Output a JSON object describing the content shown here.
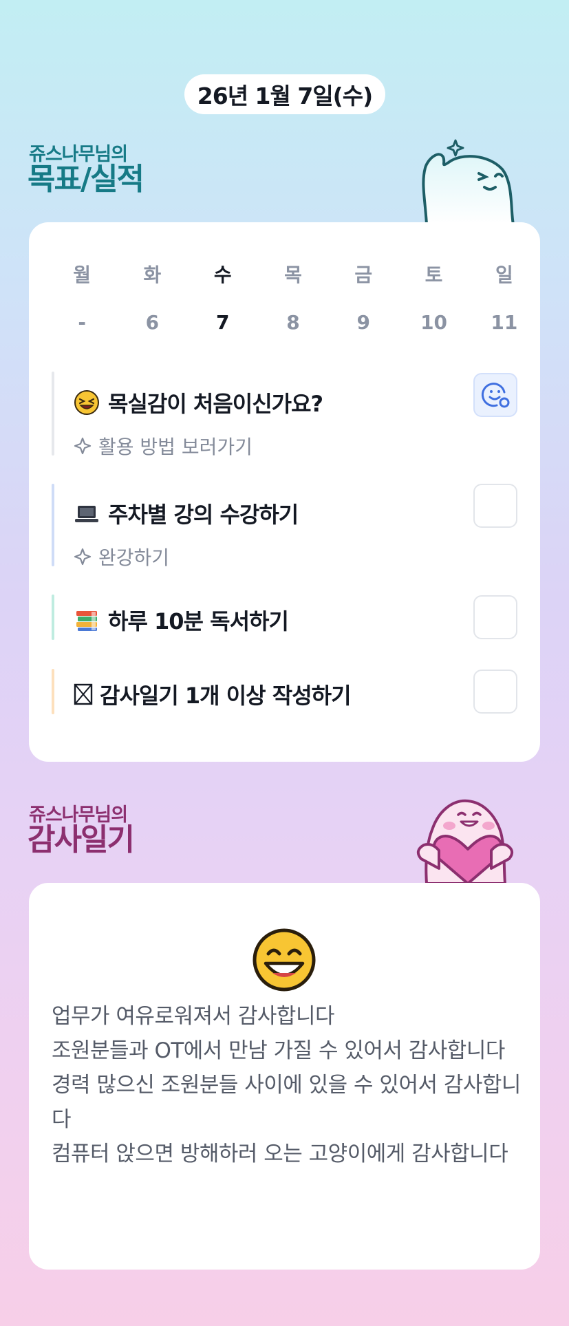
{
  "date": "26년 1월 7일(수)",
  "goals_section": {
    "subtitle": "쥬스나무님의",
    "title": "목표/실적"
  },
  "week": {
    "days": [
      "월",
      "화",
      "수",
      "목",
      "금",
      "토",
      "일"
    ],
    "dates": [
      "-",
      "6",
      "7",
      "8",
      "9",
      "10",
      "11"
    ],
    "today_index": 2
  },
  "goals": [
    {
      "emoji_icon": "grinning-squinting-face-icon",
      "title": "목실감이 처음이신가요?",
      "sub": "활용 방법 보러가기",
      "bar_color": "#e6e8ec",
      "checked_style": "active"
    },
    {
      "emoji_icon": "laptop-icon",
      "title": "주차별 강의 수강하기",
      "sub": "완강하기",
      "bar_color": "#cfdcf7"
    },
    {
      "emoji_icon": "books-icon",
      "title": "하루 10분 독서하기",
      "bar_color": "#bfece0"
    },
    {
      "emoji_icon": "ballot-box-x-icon",
      "title": "감사일기 1개 이상 작성하기",
      "bar_color": "#fde0bd"
    }
  ],
  "diary_section": {
    "subtitle": "쥬스나무님의",
    "title": "감사일기",
    "mood_icon": "grinning-face-icon",
    "lines": [
      "업무가 여유로워져서 감사합니다",
      "조원분들과 OT에서 만남 가질 수 있어서 감사합니다",
      "경력 많으신 조원분들 사이에 있을 수 있어서 감사합니다",
      "컴퓨터 앉으면 방해하러 오는 고양이에게 감사합니다"
    ]
  },
  "colors": {
    "teal_title": "#167a86",
    "plum_title": "#8c2f6f",
    "check_active_bg": "#eaf1fe",
    "check_active_icon": "#3f6fe0"
  }
}
